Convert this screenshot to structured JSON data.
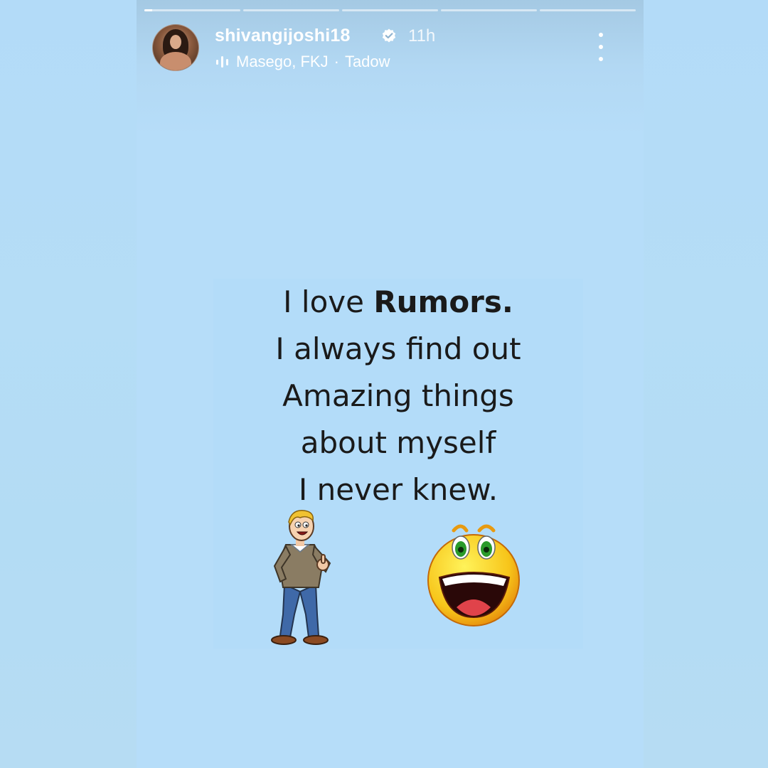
{
  "story": {
    "progress": {
      "segment_count": 5,
      "active_index": 0,
      "active_fraction": 0.08
    },
    "header": {
      "username": "shivangijoshi18",
      "verified": true,
      "time_ago": "11h",
      "music_label": "Masego, FKJ",
      "separator": "·",
      "track_title": "Tadow"
    },
    "icons": {
      "verified": "verified-badge-icon",
      "music": "music-bars-icon",
      "more": "more-vertical-icon"
    },
    "post": {
      "line1_prefix": "I love ",
      "line1_bold": "Rumors.",
      "line2": "I always find out",
      "line3": "Amazing things",
      "line4": "about myself",
      "line5": "I never knew."
    }
  },
  "colors": {
    "background": "#b4dbf6",
    "story_background": "#b6ddf9",
    "text_dark": "#1a1a1a",
    "header_text": "#ffffff",
    "verified_badge": "#ffffff"
  }
}
